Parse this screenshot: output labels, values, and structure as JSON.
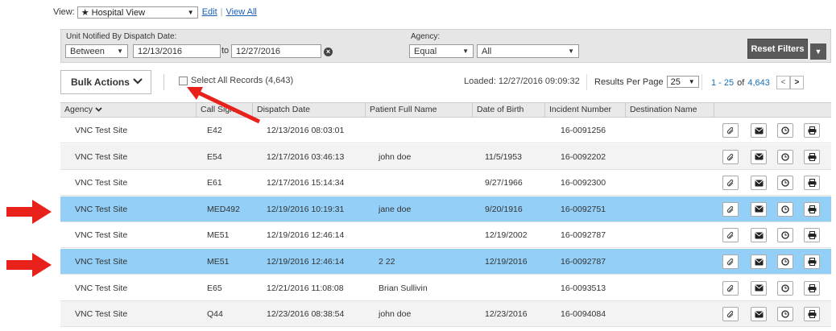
{
  "view": {
    "label": "View:",
    "selected": "★ Hospital View",
    "edit_link": "Edit",
    "view_all_link": "View All"
  },
  "filters": {
    "date_label": "Unit Notified By Dispatch Date:",
    "date_op": "Between",
    "date_from": "12/13/2016",
    "to_label": "to",
    "date_to": "12/27/2016",
    "agency_label": "Agency:",
    "agency_op": "Equal",
    "agency_value": "All",
    "reset_label": "Reset Filters"
  },
  "actions": {
    "bulk_label": "Bulk Actions",
    "select_all_label": "Select All Records (4,643)",
    "loaded": "Loaded: 12/27/2016 09:09:32",
    "rpp_label": "Results Per Page",
    "rpp_value": "25",
    "pager_range": "1 - 25",
    "pager_of": "of",
    "pager_total": "4,643"
  },
  "table": {
    "headers": [
      "Agency",
      "Call Sign",
      "Dispatch Date",
      "Patient Full Name",
      "Date of Birth",
      "Incident Number",
      "Destination Name"
    ],
    "rows": [
      {
        "agency": "VNC Test Site",
        "call_sign": "E42",
        "dispatch": "12/13/2016 08:03:01",
        "patient": "",
        "dob": "",
        "incident": "16-0091256",
        "highlight": false
      },
      {
        "agency": "VNC Test Site",
        "call_sign": "E54",
        "dispatch": "12/17/2016 03:46:13",
        "patient": "john doe",
        "dob": "11/5/1953",
        "incident": "16-0092202",
        "highlight": false
      },
      {
        "agency": "VNC Test Site",
        "call_sign": "E61",
        "dispatch": "12/17/2016 15:14:34",
        "patient": "",
        "dob": "9/27/1966",
        "incident": "16-0092300",
        "highlight": false
      },
      {
        "agency": "VNC Test Site",
        "call_sign": "MED492",
        "dispatch": "12/19/2016 10:19:31",
        "patient": "jane doe",
        "dob": "9/20/1916",
        "incident": "16-0092751",
        "highlight": true
      },
      {
        "agency": "VNC Test Site",
        "call_sign": "ME51",
        "dispatch": "12/19/2016 12:46:14",
        "patient": "",
        "dob": "12/19/2002",
        "incident": "16-0092787",
        "highlight": false
      },
      {
        "agency": "VNC Test Site",
        "call_sign": "ME51",
        "dispatch": "12/19/2016 12:46:14",
        "patient": "2 22",
        "dob": "12/19/2016",
        "incident": "16-0092787",
        "highlight": true
      },
      {
        "agency": "VNC Test Site",
        "call_sign": "E65",
        "dispatch": "12/21/2016 11:08:08",
        "patient": "Brian Sullivin",
        "dob": "",
        "incident": "16-0093513",
        "highlight": false
      },
      {
        "agency": "VNC Test Site",
        "call_sign": "Q44",
        "dispatch": "12/23/2016 08:38:54",
        "patient": "john doe",
        "dob": "12/23/2016",
        "incident": "16-0094084",
        "highlight": false
      }
    ],
    "row_actions": [
      "attach-icon",
      "envelope-icon",
      "clock-icon",
      "print-icon"
    ]
  },
  "colors": {
    "highlight_row": "#93cff6",
    "annotation_arrow": "#e8211b",
    "link": "#1a5fb4",
    "reset_button": "#5a5a5a"
  }
}
